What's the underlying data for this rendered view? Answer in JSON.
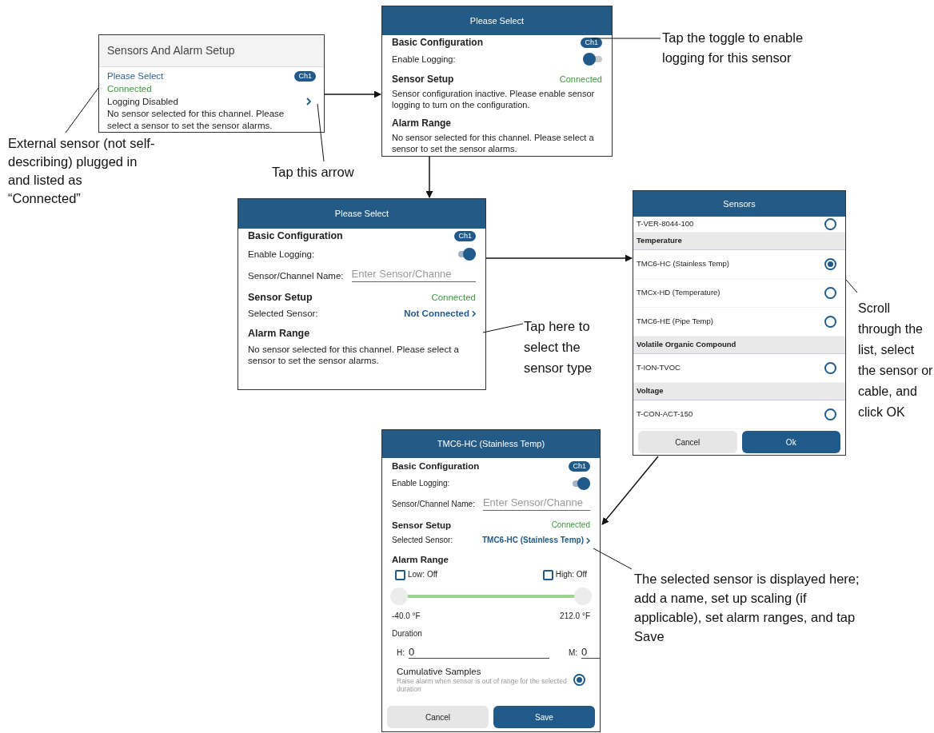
{
  "channel_card": {
    "title": "Sensors And Alarm Setup",
    "name": "Please Select",
    "badge": "Ch1",
    "status": "Connected",
    "logging": "Logging Disabled",
    "message": "No sensor selected for this channel. Please select a sensor to set the sensor alarms."
  },
  "config_screens": [
    {
      "title": "Please Select",
      "basic_heading": "Basic Configuration",
      "badge": "Ch1",
      "logging_label": "Enable Logging:",
      "logging_on": false,
      "setup_heading": "Sensor Setup",
      "setup_status": "Connected",
      "setup_message": "Sensor configuration inactive. Please enable sensor logging to turn on the configuration.",
      "alarm_heading": "Alarm Range",
      "alarm_message": "No sensor selected for this channel. Please select a sensor to set the sensor alarms."
    },
    {
      "title": "Please Select",
      "basic_heading": "Basic Configuration",
      "badge": "Ch1",
      "logging_label": "Enable Logging:",
      "logging_on": true,
      "name_label": "Sensor/Channel Name:",
      "name_placeholder": "Enter Sensor/Channe",
      "setup_heading": "Sensor Setup",
      "setup_status": "Connected",
      "selected_label": "Selected Sensor:",
      "selected_value": "Not Connected",
      "alarm_heading": "Alarm Range",
      "alarm_message": "No sensor selected for this channel. Please select a sensor to set the sensor alarms."
    },
    {
      "title": "TMC6-HC (Stainless Temp)",
      "basic_heading": "Basic Configuration",
      "badge": "Ch1",
      "logging_label": "Enable Logging:",
      "logging_on": true,
      "name_label": "Sensor/Channel Name:",
      "name_placeholder": "Enter Sensor/Channe",
      "setup_heading": "Sensor Setup",
      "setup_status": "Connected",
      "selected_label": "Selected Sensor:",
      "selected_value": "TMC6-HC (Stainless Temp)",
      "alarm_heading": "Alarm Range",
      "checkboxes": [
        {
          "label": "Low: Off",
          "checked": false
        },
        {
          "label": "High: Off",
          "checked": false
        }
      ],
      "slider": {
        "thumbs": [
          {
            "level": 0
          },
          {
            "level": 1
          }
        ]
      },
      "range_labels": [
        "-40.0 °F",
        "212.0 °F"
      ],
      "duration_label": "Duration",
      "duration_fields": [
        {
          "label": "H:",
          "value": "0"
        },
        {
          "label": "M:",
          "value": "0"
        }
      ],
      "cumulative": {
        "title": "Cumulative Samples",
        "description": "Raise alarm when sensor is out of range for the selected duration",
        "selected": true
      },
      "buttons": [
        {
          "label": "Cancel",
          "kind": "secondary"
        },
        {
          "label": "Save",
          "kind": "primary"
        }
      ]
    }
  ],
  "sensor_picker": {
    "title": "Sensors",
    "items": [
      {
        "kind": "option",
        "label": "T-VER-8044-100",
        "selected": false
      },
      {
        "kind": "group",
        "label": "Temperature"
      },
      {
        "kind": "option",
        "label": "TMC6-HC (Stainless Temp)",
        "selected": true
      },
      {
        "kind": "option",
        "label": "TMCx-HD (Temperature)",
        "selected": false
      },
      {
        "kind": "option",
        "label": "TMC6-HE (Pipe Temp)",
        "selected": false
      },
      {
        "kind": "group",
        "label": "Volatile Organic Compound"
      },
      {
        "kind": "option",
        "label": "T-ION-TVOC",
        "selected": false
      },
      {
        "kind": "group",
        "label": "Voltage"
      },
      {
        "kind": "option",
        "label": "T-CON-ACT-150",
        "selected": false
      }
    ],
    "buttons": [
      {
        "label": "Cancel",
        "kind": "secondary"
      },
      {
        "label": "Ok",
        "kind": "primary"
      }
    ]
  },
  "notes": [
    {
      "text": "External sensor (not self-describing) plugged in and listed as “Connected”"
    },
    {
      "text": "Tap this arrow"
    },
    {
      "text": "Tap the toggle to enable logging for this sensor"
    },
    {
      "text": "Tap here to select the sensor type"
    },
    {
      "text": "Scroll through the list, select the sensor or cable, and click OK"
    },
    {
      "text": "The selected sensor is displayed here; add a name, set up scaling (if applicable), set alarm ranges, and tap Save"
    }
  ]
}
